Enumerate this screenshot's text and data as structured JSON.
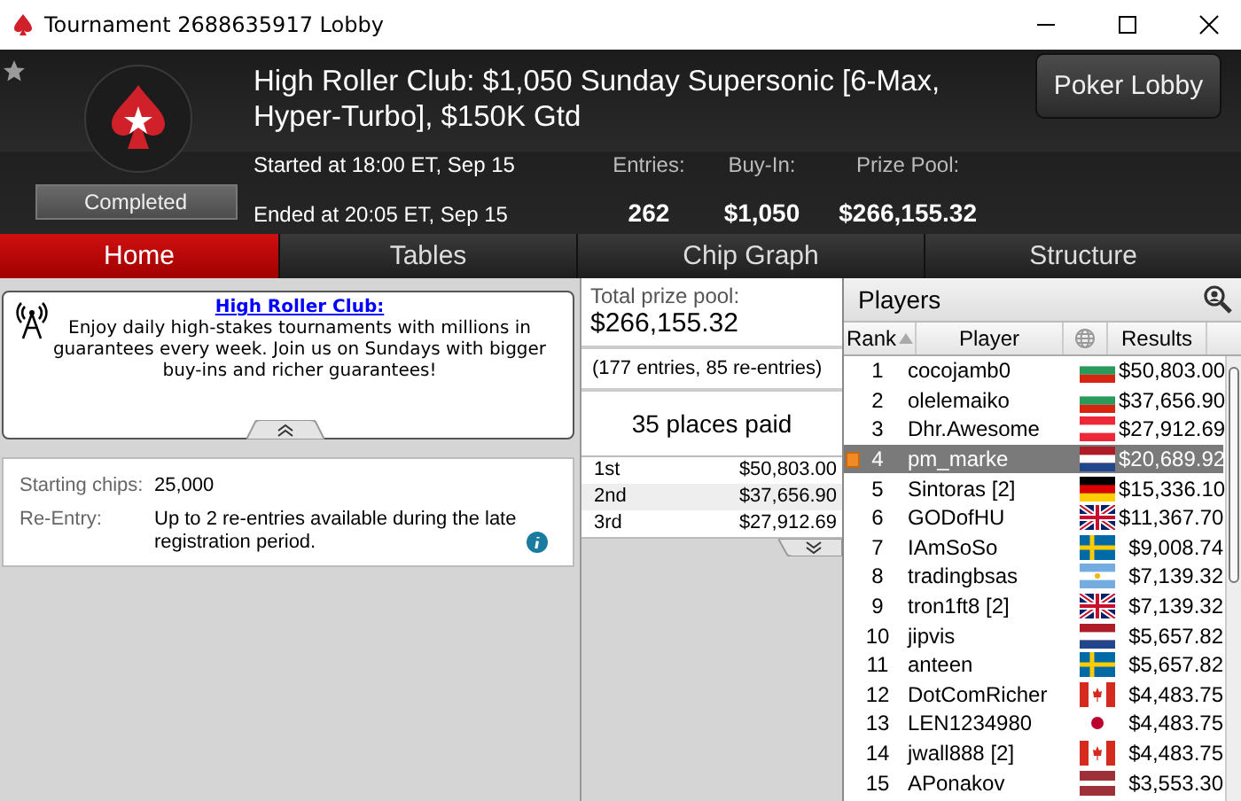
{
  "window": {
    "title": "Tournament 2688635917 Lobby"
  },
  "header": {
    "status": "Completed",
    "title": "High Roller Club: $1,050 Sunday Supersonic [6-Max, Hyper-Turbo], $150K Gtd",
    "started": "Started at 18:00 ET, Sep 15",
    "ended": "Ended at 20:05 ET, Sep 15",
    "button": "Poker Lobby",
    "stats": [
      {
        "label": "Entries:",
        "value": "262"
      },
      {
        "label": "Buy-In:",
        "value": "$1,050"
      },
      {
        "label": "Prize Pool:",
        "value": "$266,155.32"
      }
    ]
  },
  "tabs": [
    {
      "label": "Home",
      "selected": true
    },
    {
      "label": "Tables",
      "selected": false
    },
    {
      "label": "Chip Graph",
      "selected": false
    },
    {
      "label": "Structure",
      "selected": false
    }
  ],
  "promo": {
    "link": "High Roller Club:",
    "text": "Enjoy daily high-stakes tournaments with millions in guarantees every week. Join us on Sundays with bigger buy-ins and richer guarantees!"
  },
  "info": [
    {
      "label": "Starting chips:",
      "value": "25,000",
      "info_icon": false
    },
    {
      "label": "Re-Entry:",
      "value": "Up to 2 re-entries available during the late registration period.",
      "info_icon": true
    }
  ],
  "prizes": {
    "label": "Total prize pool:",
    "total": "$266,155.32",
    "entries": "(177 entries, 85 re-entries)",
    "paid": "35 places paid",
    "places": [
      {
        "place": "1st",
        "amount": "$50,803.00"
      },
      {
        "place": "2nd",
        "amount": "$37,656.90"
      },
      {
        "place": "3rd",
        "amount": "$27,912.69"
      }
    ]
  },
  "players": {
    "title": "Players",
    "columns": [
      "Rank",
      "Player",
      "Results"
    ],
    "rows": [
      {
        "rank": "1",
        "player": "cocojamb0",
        "kind": "bg",
        "result": "$50,803.00",
        "selected": false
      },
      {
        "rank": "2",
        "player": "olelemaiko",
        "kind": "bg",
        "result": "$37,656.90",
        "selected": false
      },
      {
        "rank": "3",
        "player": "Dhr.Awesome",
        "kind": "at",
        "result": "$27,912.69",
        "selected": false
      },
      {
        "rank": "4",
        "player": "pm_marke",
        "kind": "nl",
        "result": "$20,689.92",
        "selected": true
      },
      {
        "rank": "5",
        "player": "Sintoras [2]",
        "kind": "de",
        "result": "$15,336.10",
        "selected": false
      },
      {
        "rank": "6",
        "player": "GODofHU",
        "kind": "gb",
        "result": "$11,367.70",
        "selected": false
      },
      {
        "rank": "7",
        "player": "IAmSoSo",
        "kind": "se",
        "result": "$9,008.74",
        "selected": false
      },
      {
        "rank": "8",
        "player": "tradingbsas",
        "kind": "ar",
        "result": "$7,139.32",
        "selected": false
      },
      {
        "rank": "9",
        "player": "tron1ft8 [2]",
        "kind": "gb",
        "result": "$7,139.32",
        "selected": false
      },
      {
        "rank": "10",
        "player": "jipvis",
        "kind": "nl",
        "result": "$5,657.82",
        "selected": false
      },
      {
        "rank": "11",
        "player": "anteen",
        "kind": "se",
        "result": "$5,657.82",
        "selected": false
      },
      {
        "rank": "12",
        "player": "DotComRicher",
        "kind": "ca",
        "result": "$4,483.75",
        "selected": false
      },
      {
        "rank": "13",
        "player": "LEN1234980",
        "kind": "jp",
        "result": "$4,483.75",
        "selected": false
      },
      {
        "rank": "14",
        "player": "jwall888 [2]",
        "kind": "ca",
        "result": "$4,483.75",
        "selected": false
      },
      {
        "rank": "15",
        "player": "APonakov",
        "kind": "lv",
        "result": "$3,553.30",
        "selected": false
      }
    ]
  }
}
